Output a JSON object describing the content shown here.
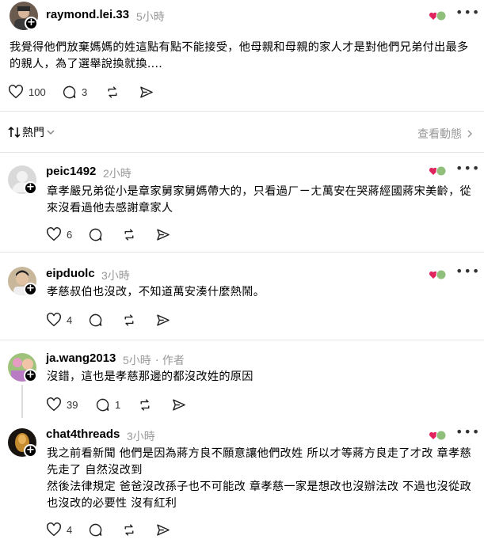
{
  "main_post": {
    "username": "raymond.lei.33",
    "time": "5小時",
    "body": "我覺得他們放棄媽媽的姓這點有點不能接受，他母親和母親的家人才是對他們兄弟付出最多的親人，為了選舉說換就換....",
    "like_count": "100",
    "reply_count": "3"
  },
  "sort_bar": {
    "label": "熱門",
    "view_activity": "查看動態"
  },
  "comments": [
    {
      "username": "peic1492",
      "time": "2小時",
      "author_tag": "",
      "body": "章孝嚴兄弟從小是章家舅家舅媽帶大的，只看過ㄏㄧㄤ萬安在哭蔣經國蔣宋美齡，從來沒看過他去感謝章家人",
      "like_count": "6",
      "reply_count": ""
    },
    {
      "username": "eipduolc",
      "time": "3小時",
      "author_tag": "",
      "body": "孝慈叔伯也沒改，不知道萬安湊什麼熱鬧。",
      "like_count": "4",
      "reply_count": ""
    },
    {
      "username": "ja.wang2013",
      "time": "5小時",
      "author_tag": "· 作者",
      "body": "沒錯，這也是孝慈那邊的都沒改姓的原因",
      "like_count": "39",
      "reply_count": "1"
    },
    {
      "username": "chat4threads",
      "time": "3小時",
      "author_tag": "",
      "body": "我之前看新聞 他們是因為蔣方良不願意讓他們改姓 所以才等蔣方良走了才改 章孝慈先走了 自然沒改到\n然後法律規定 爸爸沒改孫子也不可能改 章孝慈一家是想改也沒辦法改 不過也沒從政也沒改的必要性 沒有紅利",
      "like_count": "4",
      "reply_count": ""
    }
  ],
  "icons": [
    "heart-icon",
    "comment-icon",
    "repost-icon",
    "share-icon",
    "more-icon",
    "plus-icon",
    "sort-icon",
    "chevron-down-icon",
    "chevron-right-icon"
  ]
}
